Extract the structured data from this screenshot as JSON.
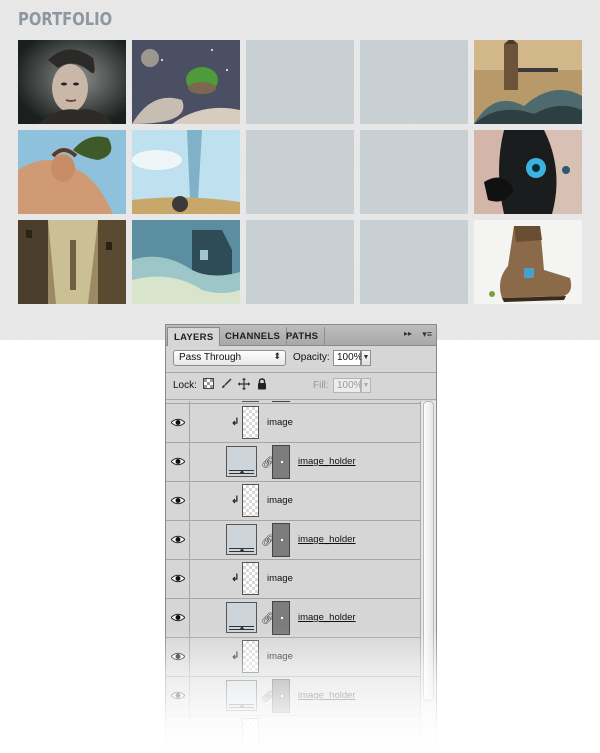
{
  "portfolio": {
    "title": "PORTFOLIO",
    "thumbnails": [
      {
        "row": 1,
        "col": 1,
        "kind": "image",
        "subject": "woman portrait"
      },
      {
        "row": 1,
        "col": 2,
        "kind": "image",
        "subject": "fantasy island"
      },
      {
        "row": 1,
        "col": 3,
        "kind": "placeholder"
      },
      {
        "row": 1,
        "col": 4,
        "kind": "placeholder"
      },
      {
        "row": 1,
        "col": 5,
        "kind": "image",
        "subject": "tower bridge wave"
      },
      {
        "row": 2,
        "col": 1,
        "kind": "image",
        "subject": "woman with tree"
      },
      {
        "row": 2,
        "col": 2,
        "kind": "image",
        "subject": "glass tower sky"
      },
      {
        "row": 2,
        "col": 3,
        "kind": "placeholder"
      },
      {
        "row": 2,
        "col": 4,
        "kind": "placeholder"
      },
      {
        "row": 2,
        "col": 5,
        "kind": "image",
        "subject": "robotic face"
      },
      {
        "row": 3,
        "col": 1,
        "kind": "image",
        "subject": "ruined city"
      },
      {
        "row": 3,
        "col": 2,
        "kind": "image",
        "subject": "flooded house"
      },
      {
        "row": 3,
        "col": 3,
        "kind": "placeholder"
      },
      {
        "row": 3,
        "col": 4,
        "kind": "placeholder"
      },
      {
        "row": 3,
        "col": 5,
        "kind": "image",
        "subject": "boot house"
      }
    ],
    "placeholder_color": "#c9d0d4"
  },
  "layers_panel": {
    "tabs": [
      {
        "label": "LAYERS",
        "active": true
      },
      {
        "label": "CHANNELS",
        "active": false
      },
      {
        "label": "PATHS",
        "active": false
      }
    ],
    "menu_arrows": "▸▸",
    "menu_icon": "▾≡",
    "blend_mode": "Pass Through",
    "blend_arrow": "⬍",
    "opacity_label": "Opacity:",
    "opacity_value": "100%",
    "lock_label": "Lock:",
    "fill_label": "Fill:",
    "fill_value": "100%",
    "layers": [
      {
        "name": "image",
        "type": "clipped",
        "visible": true
      },
      {
        "name": "image_holder",
        "type": "holder",
        "visible": true
      },
      {
        "name": "image",
        "type": "clipped",
        "visible": true
      },
      {
        "name": "image_holder",
        "type": "holder",
        "visible": true
      },
      {
        "name": "image",
        "type": "clipped",
        "visible": true
      },
      {
        "name": "image_holder",
        "type": "holder",
        "visible": true
      },
      {
        "name": "image",
        "type": "clipped",
        "visible": true
      },
      {
        "name": "image_holder",
        "type": "holder",
        "visible": true
      }
    ],
    "icons": {
      "eye": "eye-icon",
      "clip_arrow": "↲",
      "chain": "chain-icon",
      "lock_transparent": "checker-lock-icon",
      "lock_paint": "brush-icon",
      "lock_move": "move-icon",
      "lock_all": "padlock-icon"
    }
  }
}
